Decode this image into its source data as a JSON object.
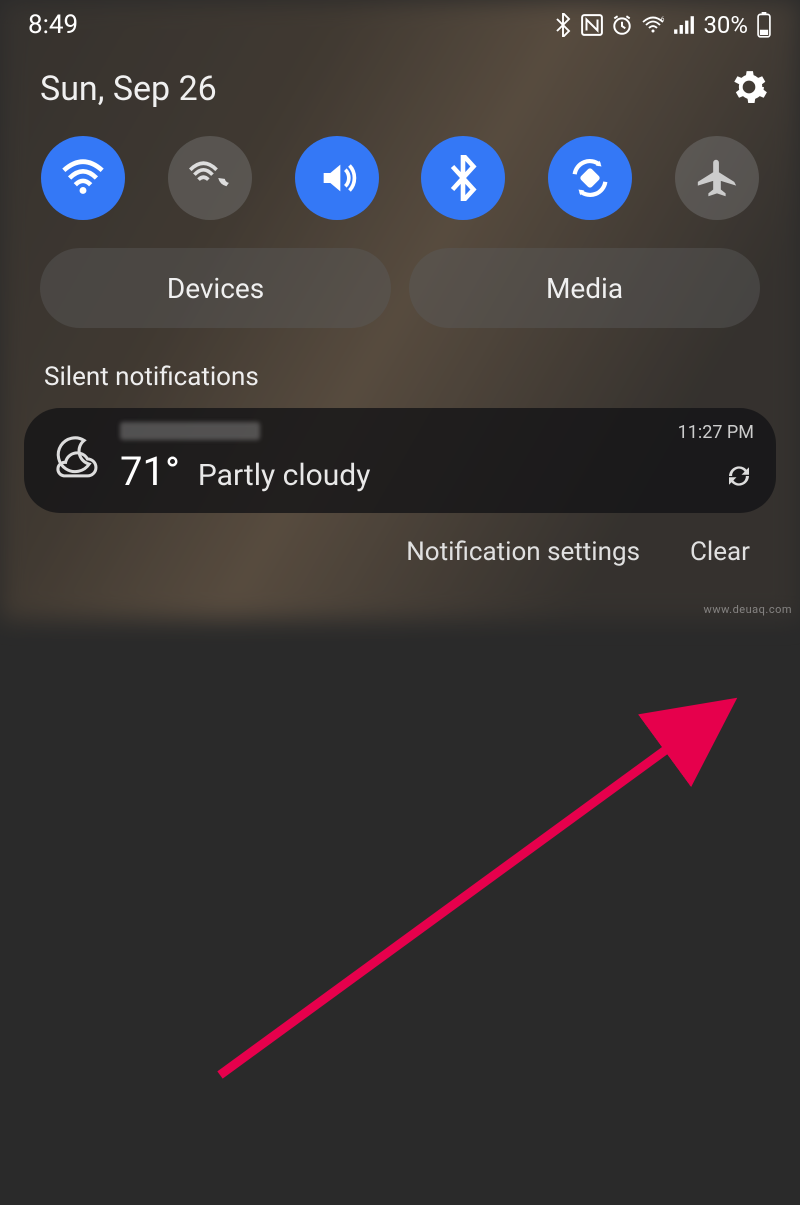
{
  "status": {
    "time": "8:49",
    "battery_text": "30%"
  },
  "date": "Sun, Sep 26",
  "pills": {
    "devices": "Devices",
    "media": "Media"
  },
  "section": {
    "silent": "Silent notifications"
  },
  "weather": {
    "temp": "71°",
    "condition": "Partly cloudy",
    "time": "11:27 PM"
  },
  "actions": {
    "settings": "Notification settings",
    "clear": "Clear"
  },
  "watermark": "www.deuaq.com",
  "colors": {
    "accent": "#3478f6",
    "arrow": "#e6004c"
  }
}
